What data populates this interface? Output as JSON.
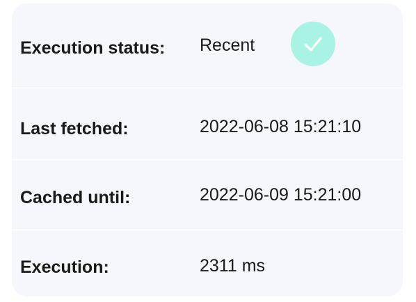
{
  "status_card": {
    "rows": [
      {
        "label": "Execution status:",
        "value": "Recent",
        "icon": "check-circle-icon"
      },
      {
        "label": "Last fetched:",
        "value": "2022-06-08 15:21:10"
      },
      {
        "label": "Cached until:",
        "value": "2022-06-09 15:21:00"
      },
      {
        "label": "Execution:",
        "value": "2311 ms"
      }
    ],
    "colors": {
      "card_background": "#f6f7fc",
      "badge_background": "#a8f3e3",
      "checkmark": "#ffffff",
      "text": "#1a1a1a"
    }
  }
}
